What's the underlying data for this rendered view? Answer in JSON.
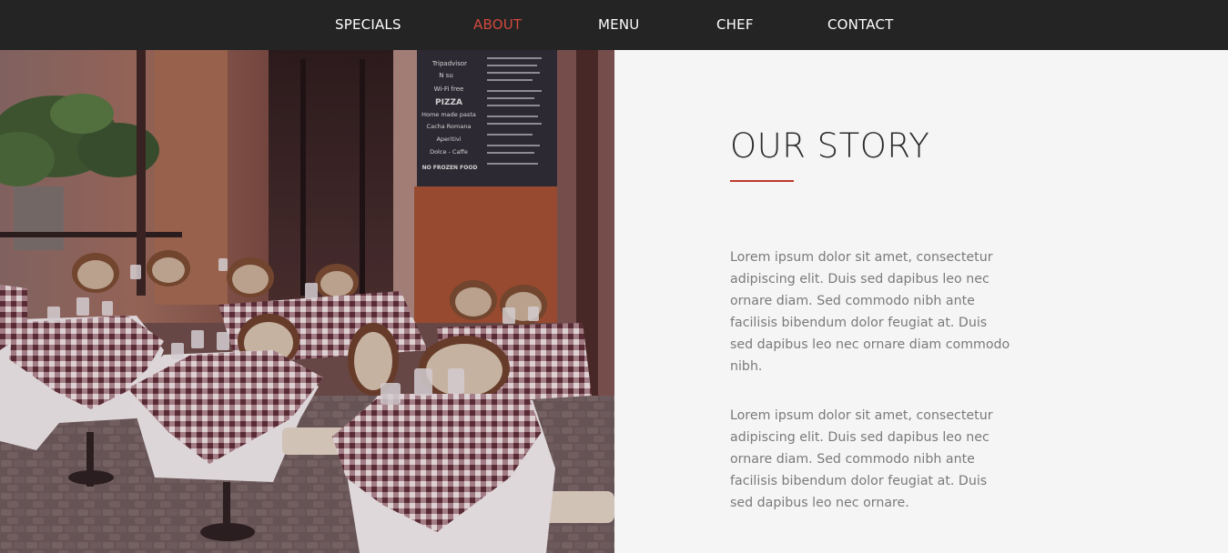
{
  "nav": {
    "items": [
      {
        "label": "SPECIALS",
        "active": false
      },
      {
        "label": "ABOUT",
        "active": true
      },
      {
        "label": "MENU",
        "active": false
      },
      {
        "label": "CHEF",
        "active": false
      },
      {
        "label": "CONTACT",
        "active": false
      }
    ],
    "active_color": "#d2493e",
    "background": "#242424"
  },
  "photo": {
    "signboard": {
      "lines": [
        "Tripadvisor",
        "N          su",
        "Wi-Fi free",
        "PIZZA",
        "Home made pasta",
        "Cacha Romana",
        "Aperitivi",
        "Dolce - Caffe",
        "NO FROZEN FOOD"
      ]
    }
  },
  "story": {
    "title": "OUR STORY",
    "accent_color": "#c0392b",
    "paragraphs": [
      "Lorem ipsum dolor sit amet, consectetur adipiscing elit. Duis sed dapibus leo nec ornare diam. Sed commodo nibh ante facilisis bibendum dolor feugiat at. Duis sed dapibus leo nec ornare diam commodo nibh.",
      "Lorem ipsum dolor sit amet, consectetur adipiscing elit. Duis sed dapibus leo nec ornare diam. Sed commodo nibh ante facilisis bibendum dolor feugiat at. Duis sed dapibus leo nec ornare."
    ]
  }
}
